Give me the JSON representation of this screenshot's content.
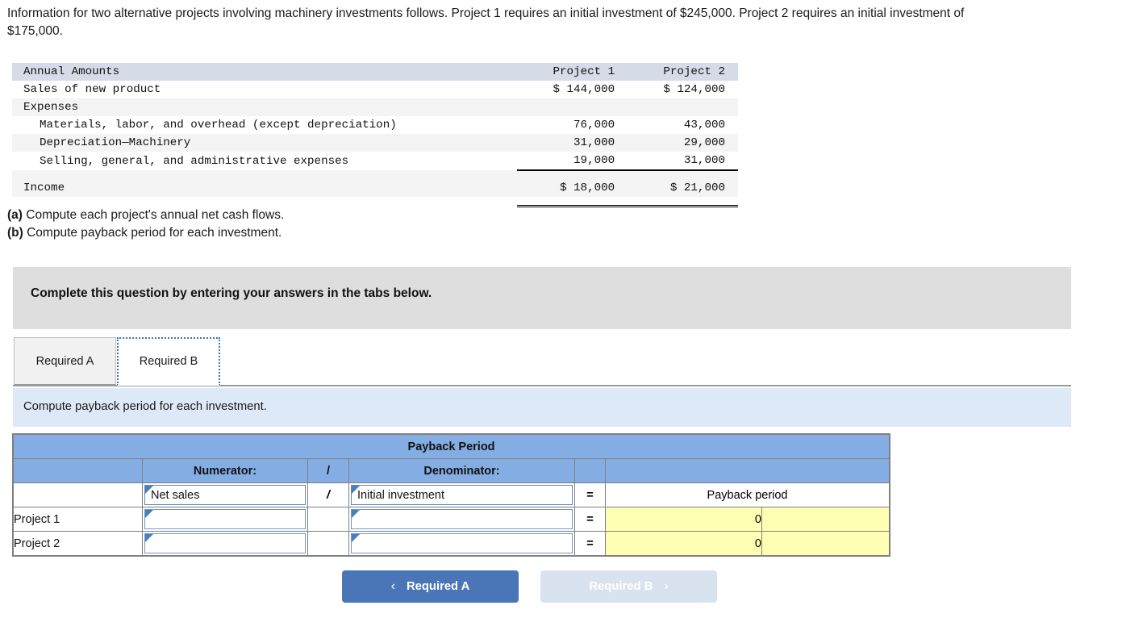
{
  "intro": {
    "text": "Information for two alternative projects involving machinery investments follows. Project 1 requires an initial investment of $245,000. Project 2 requires an initial investment of $175,000."
  },
  "financials": {
    "columns": [
      "Annual Amounts",
      "Project 1",
      "Project 2"
    ],
    "rows": [
      {
        "label": "Sales of new product",
        "indent": 0,
        "p1": "$ 144,000",
        "p2": "$ 124,000"
      },
      {
        "label": "Expenses",
        "indent": 0,
        "p1": "",
        "p2": ""
      },
      {
        "label": "Materials, labor, and overhead (except depreciation)",
        "indent": 1,
        "p1": "76,000",
        "p2": "43,000"
      },
      {
        "label": "Depreciation—Machinery",
        "indent": 1,
        "p1": "31,000",
        "p2": "29,000"
      },
      {
        "label": "Selling, general, and administrative expenses",
        "indent": 1,
        "p1": "19,000",
        "p2": "31,000"
      },
      {
        "label": "Income",
        "indent": 0,
        "p1": "$ 18,000",
        "p2": "$ 21,000"
      }
    ]
  },
  "requirements": [
    {
      "marker": "(a)",
      "text": "Compute each project's annual net cash flows."
    },
    {
      "marker": "(b)",
      "text": "Compute payback period for each investment."
    }
  ],
  "banner": {
    "text": "Complete this question by entering your answers in the tabs below."
  },
  "tabs": [
    {
      "label": "Required A",
      "active": false
    },
    {
      "label": "Required B",
      "active": true
    }
  ],
  "sub_instruction": {
    "text": "Compute payback period for each investment."
  },
  "payback_table": {
    "title": "Payback Period",
    "subheaders": {
      "blank_left": "",
      "numerator": "Numerator:",
      "slash": "/",
      "denominator": "Denominator:",
      "equals_blank": "",
      "result_blank": ""
    },
    "formula_row": {
      "label": "",
      "numerator": "Net sales",
      "slash": "/",
      "denominator": "Initial investment",
      "equals": "=",
      "result": "Payback period"
    },
    "rows": [
      {
        "label": "Project 1",
        "numerator": "",
        "numerator_placeholder": "",
        "slash": "",
        "denominator": "",
        "denominator_placeholder": "",
        "equals": "=",
        "result": "0",
        "result_unit": ""
      },
      {
        "label": "Project 2",
        "numerator": "",
        "numerator_placeholder": "",
        "slash": "",
        "denominator": "",
        "denominator_placeholder": "",
        "equals": "=",
        "result": "0",
        "result_unit": ""
      }
    ]
  },
  "nav": {
    "prev_label": "Required A",
    "prev_chevron": "‹",
    "next_label": "Required B",
    "next_chevron": "›"
  },
  "colors": {
    "header_blue": "#84ade4",
    "button_blue": "#4a76b8",
    "button_disabled": "#d9e3ef",
    "answer_yellow": "#ffffb3",
    "instruction_blue": "#dee9f7",
    "banner_gray": "#dedede",
    "fin_header_gray": "#d5dce8"
  }
}
